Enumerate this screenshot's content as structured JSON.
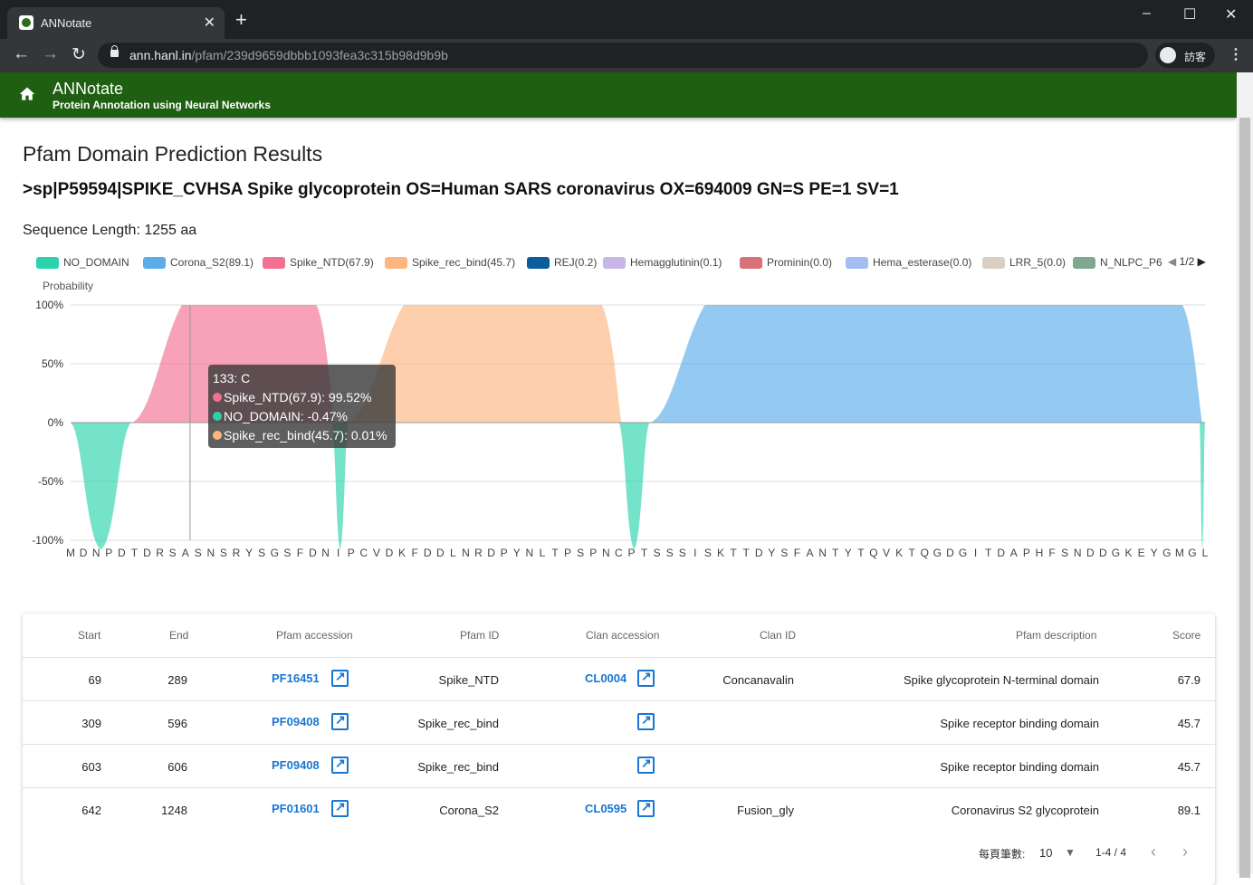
{
  "browser": {
    "tab_title": "ANNotate",
    "url_host": "ann.hanl.in",
    "url_path": "/pfam/239d9659dbbb1093fea3c315b98d9b9b",
    "profile_name": "訪客",
    "icons": [
      "favicon-icon",
      "close-icon",
      "plus-icon",
      "minimize-icon",
      "maximize-icon",
      "close-window-icon",
      "back-icon",
      "forward-icon",
      "reload-icon",
      "lock-icon",
      "avatar-icon",
      "menu-icon"
    ]
  },
  "app": {
    "title": "ANNotate",
    "subtitle": "Protein Annotation using Neural Networks",
    "home_icon": "home-icon"
  },
  "page": {
    "heading": "Pfam Domain Prediction Results",
    "sequence_header": ">sp|P59594|SPIKE_CVHSA Spike glycoprotein OS=Human SARS coronavirus OX=694009 GN=S PE=1 SV=1",
    "sequence_length": "Sequence Length: 1255 aa"
  },
  "chart_data": {
    "type": "area",
    "ylabel": "Probability",
    "ylim": [
      -100,
      100
    ],
    "yticks": [
      "100%",
      "50%",
      "0%",
      "-50%",
      "-100%"
    ],
    "xlabels": [
      "M",
      "D",
      "N",
      "P",
      "D",
      "T",
      "D",
      "R",
      "S",
      "A",
      "S",
      "N",
      "S",
      "R",
      "Y",
      "S",
      "G",
      "S",
      "F",
      "D",
      "N",
      "I",
      "P",
      "C",
      "V",
      "D",
      "K",
      "F",
      "D",
      "D",
      "L",
      "N",
      "R",
      "D",
      "P",
      "Y",
      "N",
      "L",
      "T",
      "P",
      "S",
      "P",
      "N",
      "C",
      "P",
      "T",
      "S",
      "S",
      "S",
      "I",
      "S",
      "K",
      "T",
      "T",
      "D",
      "Y",
      "S",
      "F",
      "A",
      "N",
      "T",
      "Y",
      "T",
      "Q",
      "V",
      "K",
      "T",
      "Q",
      "G",
      "D",
      "G",
      "I",
      "T",
      "D",
      "A",
      "P",
      "H",
      "F",
      "S",
      "N",
      "D",
      "D",
      "G",
      "K",
      "E",
      "Y",
      "G",
      "M",
      "G",
      "L"
    ],
    "legend_page": "1/2",
    "series": [
      {
        "name": "NO_DOMAIN",
        "color": "#2bd3ad"
      },
      {
        "name": "Corona_S2(89.1)",
        "color": "#5aade9"
      },
      {
        "name": "Spike_NTD(67.9)",
        "color": "#f27090"
      },
      {
        "name": "Spike_rec_bind(45.7)",
        "color": "#fdb67f"
      },
      {
        "name": "REJ(0.2)",
        "color": "#0b5e9e"
      },
      {
        "name": "Hemagglutinin(0.1)",
        "color": "#c7b6e8"
      },
      {
        "name": "Prominin(0.0)",
        "color": "#d97278"
      },
      {
        "name": "Hema_esterase(0.0)",
        "color": "#a4bdf5"
      },
      {
        "name": "LRR_5(0.0)",
        "color": "#d9cfc3"
      },
      {
        "name": "N_NLPC_P6",
        "color": "#7ea890"
      }
    ],
    "regions": [
      {
        "series": "NO_DOMAIN",
        "start": 1,
        "end": 68,
        "value": -100
      },
      {
        "series": "Spike_NTD(67.9)",
        "start": 69,
        "end": 289,
        "value": 100
      },
      {
        "series": "NO_DOMAIN",
        "start": 290,
        "end": 308,
        "value": -100
      },
      {
        "series": "Spike_rec_bind(45.7)",
        "start": 309,
        "end": 606,
        "value": 100
      },
      {
        "series": "NO_DOMAIN",
        "start": 607,
        "end": 641,
        "value": -100
      },
      {
        "series": "Corona_S2(89.1)",
        "start": 642,
        "end": 1248,
        "value": 100
      },
      {
        "series": "NO_DOMAIN",
        "start": 1249,
        "end": 1255,
        "value": -100
      }
    ],
    "tooltip": {
      "title": "133: C",
      "lines": [
        {
          "label": "Spike_NTD(67.9): 99.52%",
          "color": "#f27090"
        },
        {
          "label": "NO_DOMAIN: -0.47%",
          "color": "#2bd3ad"
        },
        {
          "label": "Spike_rec_bind(45.7): 0.01%",
          "color": "#fdb67f"
        }
      ]
    }
  },
  "table": {
    "headers": [
      "Start",
      "End",
      "Pfam accession",
      "Pfam ID",
      "Clan accession",
      "Clan ID",
      "Pfam description",
      "Score"
    ],
    "rows": [
      {
        "start": "69",
        "end": "289",
        "pfam_acc": "PF16451",
        "pfam_id": "Spike_NTD",
        "clan_acc": "CL0004",
        "clan_id": "Concanavalin",
        "desc": "Spike glycoprotein N-terminal domain",
        "score": "67.9"
      },
      {
        "start": "309",
        "end": "596",
        "pfam_acc": "PF09408",
        "pfam_id": "Spike_rec_bind",
        "clan_acc": "",
        "clan_id": "",
        "desc": "Spike receptor binding domain",
        "score": "45.7"
      },
      {
        "start": "603",
        "end": "606",
        "pfam_acc": "PF09408",
        "pfam_id": "Spike_rec_bind",
        "clan_acc": "",
        "clan_id": "",
        "desc": "Spike receptor binding domain",
        "score": "45.7"
      },
      {
        "start": "642",
        "end": "1248",
        "pfam_acc": "PF01601",
        "pfam_id": "Corona_S2",
        "clan_acc": "CL0595",
        "clan_id": "Fusion_gly",
        "desc": "Coronavirus S2 glycoprotein",
        "score": "89.1"
      }
    ],
    "footer": {
      "rows_per_page_label": "每頁筆數:",
      "rows_per_page": "10",
      "range": "1-4 / 4"
    }
  }
}
